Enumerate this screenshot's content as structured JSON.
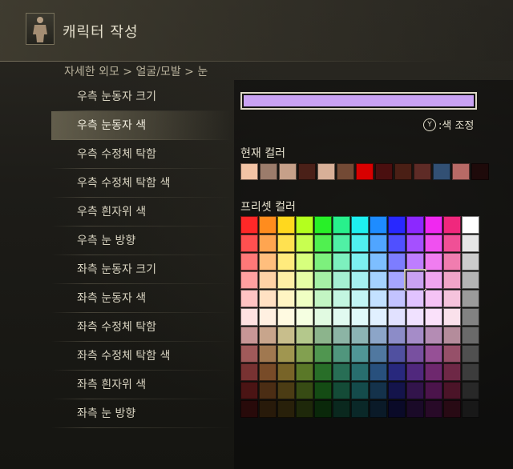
{
  "header": {
    "title": "캐릭터 작성"
  },
  "breadcrumb": "자세한 외모 > 얼굴/모발 > 눈",
  "menu": {
    "items": [
      {
        "label": "우측 눈동자 크기",
        "active": false
      },
      {
        "label": "우측 눈동자 색",
        "active": true
      },
      {
        "label": "우측 수정체 탁함",
        "active": false
      },
      {
        "label": "우측 수정체 탁함 색",
        "active": false
      },
      {
        "label": "우측 흰자위 색",
        "active": false
      },
      {
        "label": "우측 눈 방향",
        "active": false
      },
      {
        "label": "좌측 눈동자 크기",
        "active": false
      },
      {
        "label": "좌측 눈동자 색",
        "active": false
      },
      {
        "label": "좌측 수정체 탁함",
        "active": false
      },
      {
        "label": "좌측 수정체 탁함 색",
        "active": false
      },
      {
        "label": "좌측 흰자위 색",
        "active": false
      },
      {
        "label": "좌측 눈 방향",
        "active": false
      }
    ]
  },
  "selected_color": "#c9a2f2",
  "hint": {
    "button": "Y",
    "label": ":색 조정"
  },
  "current_colors": {
    "label": "현재 컬러",
    "colors": [
      "#f3c4a5",
      "#9b7c6b",
      "#c6a089",
      "#4a2018",
      "#d8b098",
      "#734a35",
      "#d80000",
      "#4a0f0f",
      "#4a1f15",
      "#5e2b26",
      "#325074",
      "#b86a66",
      "#1e0a0a"
    ]
  },
  "preset_colors": {
    "label": "프리셋 컬러",
    "rows": [
      [
        "#ff2828",
        "#ff8c1e",
        "#ffd81e",
        "#b4ff1e",
        "#28f028",
        "#28f08c",
        "#1ef0f0",
        "#1e8cff",
        "#2828ff",
        "#8c28ff",
        "#f028f0",
        "#f0287d",
        "#ffffff"
      ],
      [
        "#ff5050",
        "#ffa550",
        "#ffe150",
        "#c8ff50",
        "#50f050",
        "#50f0a5",
        "#50f0f0",
        "#50a5ff",
        "#5050ff",
        "#a550ff",
        "#f050f0",
        "#f05096",
        "#e6e6e6"
      ],
      [
        "#ff7878",
        "#ffbe7d",
        "#ffeb7d",
        "#d7ff7d",
        "#7df07d",
        "#7df0be",
        "#7df0f0",
        "#7dbeff",
        "#7d7dff",
        "#be7dff",
        "#f07df0",
        "#f07daf",
        "#cccccc"
      ],
      [
        "#ffa0a0",
        "#ffd2a5",
        "#fff0a5",
        "#e6ffa5",
        "#a5f0a5",
        "#a5f0d2",
        "#a5f0f0",
        "#a5d2ff",
        "#a5a5ff",
        "#c9a2f2",
        "#f0a5f0",
        "#f0a5c8",
        "#b4b4b4"
      ],
      [
        "#ffc3c3",
        "#ffe1c3",
        "#fff5c3",
        "#f0ffc3",
        "#c3f5c3",
        "#c3f5e1",
        "#c3f5f5",
        "#c3e1ff",
        "#c3c3ff",
        "#e1c3ff",
        "#f5c3f5",
        "#f5c3dc",
        "#9b9b9b"
      ],
      [
        "#ffe1e1",
        "#fff0e1",
        "#fffae1",
        "#f5ffe1",
        "#e1fae1",
        "#e1faf0",
        "#e1fafa",
        "#e1f0ff",
        "#e1e1ff",
        "#f0e1ff",
        "#fae1fa",
        "#fae1eb",
        "#828282"
      ],
      [
        "#c89696",
        "#c8a58c",
        "#c8be8c",
        "#b4c88c",
        "#8cb48c",
        "#8cb4a5",
        "#8cb4b4",
        "#8ca5c8",
        "#8c8cc8",
        "#a58cc8",
        "#b48cb4",
        "#b48c9b",
        "#6a6a6a"
      ],
      [
        "#a05a5a",
        "#a07850",
        "#a09650",
        "#82a050",
        "#509650",
        "#50967d",
        "#509696",
        "#5078a0",
        "#5050a0",
        "#7850a0",
        "#965096",
        "#965069",
        "#505050"
      ],
      [
        "#783232",
        "#784b28",
        "#786428",
        "#5a7828",
        "#286e28",
        "#286e55",
        "#286e6e",
        "#28507d",
        "#28287d",
        "#50287d",
        "#6e286e",
        "#6e2846",
        "#3c3c3c"
      ],
      [
        "#4b1414",
        "#4b2d14",
        "#4b3c14",
        "#374b14",
        "#144b14",
        "#144b37",
        "#144b4b",
        "#14324b",
        "#14144b",
        "#32144b",
        "#4b144b",
        "#4b1428",
        "#282828"
      ],
      [
        "#280a0a",
        "#281a0a",
        "#28200a",
        "#1e280a",
        "#0a280a",
        "#0a281e",
        "#0a2828",
        "#0a1a28",
        "#0a0a28",
        "#1a0a28",
        "#280a28",
        "#280a14",
        "#181818"
      ]
    ],
    "selected": {
      "row": 3,
      "col": 9
    }
  }
}
